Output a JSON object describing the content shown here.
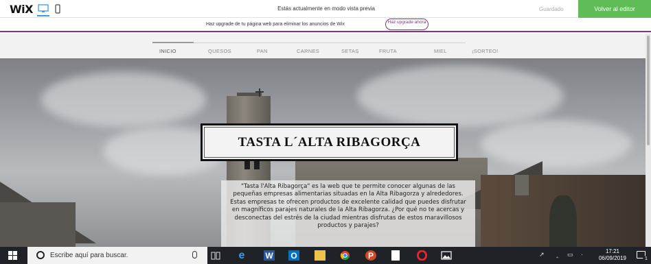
{
  "wixbar": {
    "logo": "WiX",
    "preview_message": "Estás actualmente en modo vista previa",
    "saved_label": "Guardado",
    "back_to_editor_label": "Volver al editor",
    "accent_color": "#60bc57"
  },
  "upgrade_banner": {
    "text": "Haz upgrade de tu página web para eliminar los anuncios de Wix",
    "button_label": "Haz upgrade ahora",
    "accent_color": "#8e2c8c"
  },
  "site_nav": {
    "items": [
      {
        "label": "INICIO",
        "active": true
      },
      {
        "label": "QUESOS",
        "active": false
      },
      {
        "label": "PAN",
        "active": false
      },
      {
        "label": "CARNES",
        "active": false
      },
      {
        "label": "SETAS",
        "active": false
      },
      {
        "label": "FRUTA",
        "active": false
      },
      {
        "label": "MIEL",
        "active": false
      },
      {
        "label": "¡SORTEO!",
        "active": false
      }
    ]
  },
  "hero": {
    "title": "TASTA L´ALTA RIBAGORÇA",
    "description": "\"Tasta l'Alta Ribagorça\" es la web que te permite conocer algunas de las pequeñas empresas alimentarias situadas en la Alta Ribagorza y alrededores. Estas empresas te ofrecen productos de excelente calidad que puedes disfrutar en magníficos parajes naturales de la Alta Ribagorza. ¿Por qué no te acercas y desconectas del estrés de la ciudad mientras disfrutas de estos maravillosos productos y parajes?"
  },
  "taskbar": {
    "search_placeholder": "Escribe aquí para buscar.",
    "apps": [
      "task-view-icon",
      "edge-icon",
      "word-icon",
      "outlook-icon",
      "file-explorer-icon",
      "chrome-icon",
      "powerpoint-icon",
      "notepad-icon",
      "opera-icon",
      "photos-icon"
    ],
    "time": "17:21",
    "date": "06/09/2019",
    "notification_count": "1"
  }
}
